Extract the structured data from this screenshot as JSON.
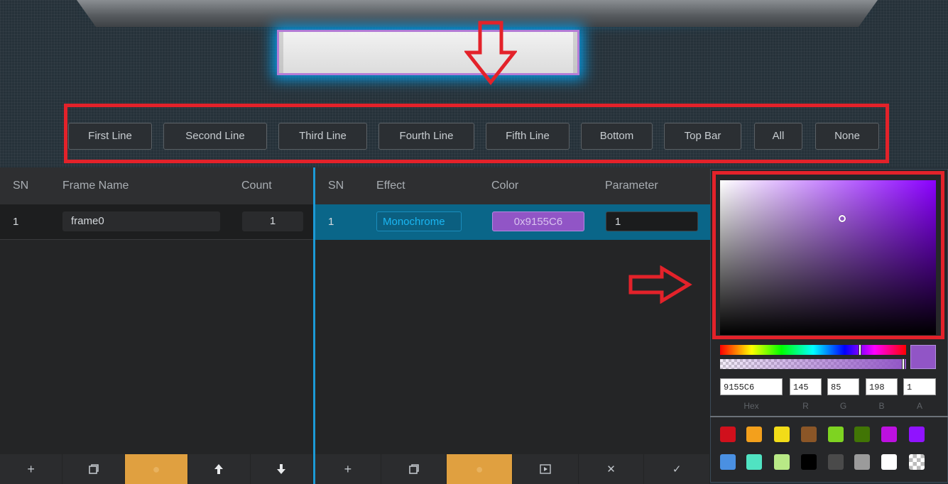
{
  "line_buttons": [
    {
      "label": "First Line"
    },
    {
      "label": "Second Line"
    },
    {
      "label": "Third Line"
    },
    {
      "label": "Fourth Line"
    },
    {
      "label": "Fifth Line"
    },
    {
      "label": "Bottom"
    },
    {
      "label": "Top Bar"
    },
    {
      "label": "All"
    },
    {
      "label": "None"
    }
  ],
  "frames": {
    "headers": {
      "sn": "SN",
      "name": "Frame Name",
      "count": "Count"
    },
    "rows": [
      {
        "sn": "1",
        "name": "frame0",
        "count": "1"
      }
    ],
    "toolbar": [
      "plus-icon",
      "copy-icon",
      "delete-icon",
      "arrow-up-icon",
      "arrow-down-icon"
    ]
  },
  "effects": {
    "headers": {
      "sn": "SN",
      "effect": "Effect",
      "color": "Color",
      "parameter": "Parameter"
    },
    "rows": [
      {
        "sn": "1",
        "effect": "Monochrome",
        "color": "0x9155C6",
        "parameter": "1"
      }
    ],
    "toolbar": [
      "plus-icon",
      "copy-icon",
      "delete-icon",
      "preview-icon",
      "close-icon",
      "check-icon"
    ]
  },
  "picker": {
    "hex": "9155C6",
    "r": "145",
    "g": "85",
    "b": "198",
    "a": "1",
    "labels": {
      "hex": "Hex",
      "r": "R",
      "g": "G",
      "b": "B",
      "a": "A"
    },
    "selected_color": "#9155c6",
    "swatches": [
      "#d0101c",
      "#f3a01c",
      "#f2dc18",
      "#8b5627",
      "#7ed321",
      "#417505",
      "#bd10e0",
      "#9013fe",
      "#4a90e2",
      "#50e3c2",
      "#b8e986",
      "#000000",
      "#4a4a4a",
      "#9b9b9b",
      "#ffffff",
      "checker"
    ]
  },
  "colors": {
    "highlight_red": "#e3222a",
    "accent_blue": "#1c9ad6",
    "active_orange": "#e0a040"
  }
}
